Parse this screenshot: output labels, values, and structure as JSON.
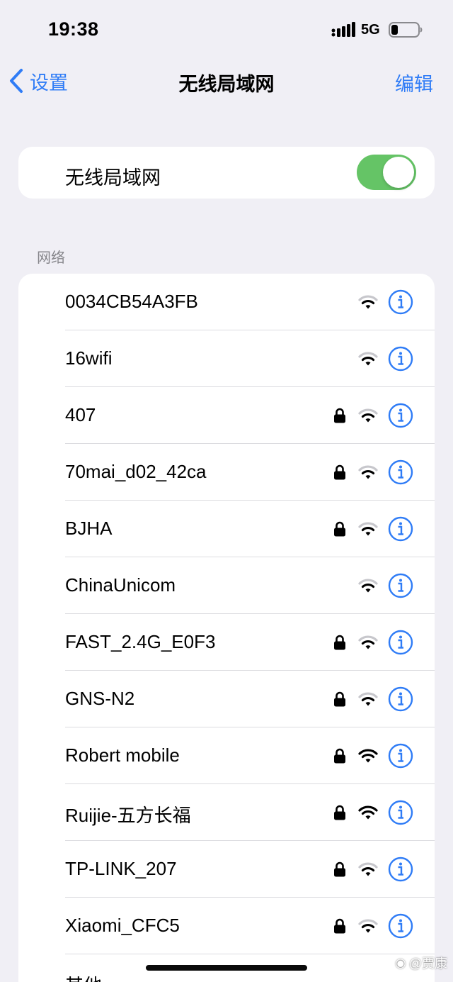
{
  "status_bar": {
    "time": "19:38",
    "network_type": "5G"
  },
  "nav": {
    "back_label": "设置",
    "title": "无线局域网",
    "edit_label": "编辑"
  },
  "wifi_toggle": {
    "label": "无线局域网",
    "on": true,
    "color": "#65c466"
  },
  "section_header": "网络",
  "accent_color": "#2f7cf6",
  "networks": [
    {
      "name": "0034CB54A3FB",
      "locked": false,
      "strong": false
    },
    {
      "name": "16wifi",
      "locked": false,
      "strong": false
    },
    {
      "name": "407",
      "locked": true,
      "strong": false
    },
    {
      "name": "70mai_d02_42ca",
      "locked": true,
      "strong": false
    },
    {
      "name": "BJHA",
      "locked": true,
      "strong": false
    },
    {
      "name": "ChinaUnicom",
      "locked": false,
      "strong": false
    },
    {
      "name": "FAST_2.4G_E0F3",
      "locked": true,
      "strong": false
    },
    {
      "name": "GNS-N2",
      "locked": true,
      "strong": false
    },
    {
      "name": "Robert mobile",
      "locked": true,
      "strong": true
    },
    {
      "name": "Ruijie-五方长福",
      "locked": true,
      "strong": true
    },
    {
      "name": "TP-LINK_207",
      "locked": true,
      "strong": false
    },
    {
      "name": "Xiaomi_CFC5",
      "locked": true,
      "strong": false
    },
    {
      "name": "其他",
      "locked": false,
      "strong": false,
      "other": true
    }
  ],
  "watermark": "@贾康"
}
